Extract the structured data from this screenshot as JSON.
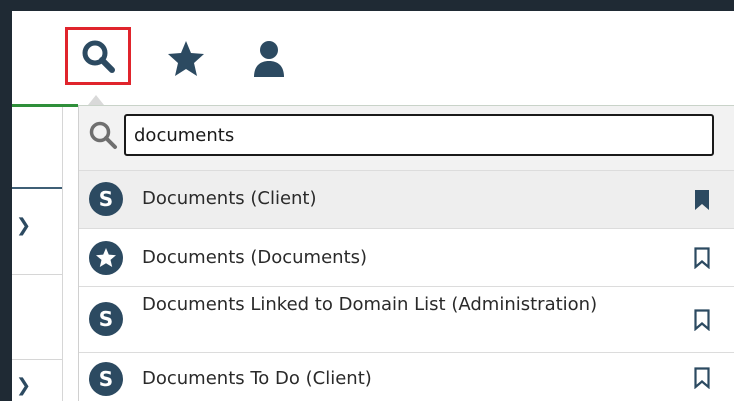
{
  "toolbar": {
    "search_icon": "search-icon",
    "favorites_icon": "star-icon",
    "user_icon": "user-icon"
  },
  "search": {
    "icon": "search-icon",
    "value": "documents"
  },
  "results": [
    {
      "badge": "S",
      "badge_type": "screen",
      "label": "Documents (Client)",
      "bookmarked": true
    },
    {
      "badge": "",
      "badge_type": "favorite",
      "label": "Documents (Documents)",
      "bookmarked": false
    },
    {
      "badge": "S",
      "badge_type": "screen",
      "label": "Documents Linked to Domain List (Administration)",
      "bookmarked": false
    },
    {
      "badge": "S",
      "badge_type": "screen",
      "label": "Documents To Do (Client)",
      "bookmarked": false
    }
  ],
  "colors": {
    "highlight_border": "#e0242c",
    "badge": "#2c4a61",
    "accent_line": "#2f8f3a"
  }
}
